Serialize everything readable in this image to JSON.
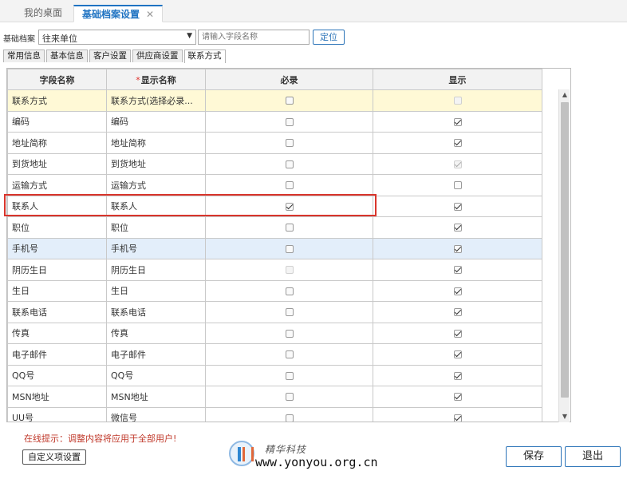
{
  "top_tabs": [
    {
      "label": "我的桌面"
    },
    {
      "label": "基础档案设置",
      "close": "✕"
    }
  ],
  "filter": {
    "label": "基础档案",
    "archive_value": "往来单位",
    "field_placeholder": "请输入字段名称",
    "locate_label": "定位"
  },
  "sub_tabs": [
    {
      "label": "常用信息"
    },
    {
      "label": "基本信息"
    },
    {
      "label": "客户设置"
    },
    {
      "label": "供应商设置"
    },
    {
      "label": "联系方式"
    }
  ],
  "grid": {
    "headers": {
      "field": "字段名称",
      "display_star": "*",
      "display": "显示名称",
      "required": "必录",
      "show": "显示"
    },
    "rows": [
      {
        "field": "联系方式",
        "display": "联系方式(选择必录...",
        "required": false,
        "required_disabled": false,
        "show": false,
        "show_disabled": true,
        "bg": "yellow"
      },
      {
        "field": "编码",
        "display": "编码",
        "required": false,
        "required_disabled": false,
        "show": true,
        "show_disabled": false,
        "bg": ""
      },
      {
        "field": "地址简称",
        "display": "地址简称",
        "required": false,
        "required_disabled": false,
        "show": true,
        "show_disabled": false,
        "bg": ""
      },
      {
        "field": "到货地址",
        "display": "到货地址",
        "required": false,
        "required_disabled": false,
        "show": true,
        "show_disabled": true,
        "bg": ""
      },
      {
        "field": "运输方式",
        "display": "运输方式",
        "required": false,
        "required_disabled": false,
        "show": false,
        "show_disabled": false,
        "bg": ""
      },
      {
        "field": "联系人",
        "display": "联系人",
        "required": true,
        "required_disabled": false,
        "show": true,
        "show_disabled": false,
        "bg": ""
      },
      {
        "field": "职位",
        "display": "职位",
        "required": false,
        "required_disabled": false,
        "show": true,
        "show_disabled": false,
        "bg": ""
      },
      {
        "field": "手机号",
        "display": "手机号",
        "required": false,
        "required_disabled": false,
        "show": true,
        "show_disabled": false,
        "bg": "blue"
      },
      {
        "field": "阴历生日",
        "display": "阴历生日",
        "required": false,
        "required_disabled": true,
        "show": true,
        "show_disabled": false,
        "bg": ""
      },
      {
        "field": "生日",
        "display": "生日",
        "required": false,
        "required_disabled": false,
        "show": true,
        "show_disabled": false,
        "bg": ""
      },
      {
        "field": "联系电话",
        "display": "联系电话",
        "required": false,
        "required_disabled": false,
        "show": true,
        "show_disabled": false,
        "bg": ""
      },
      {
        "field": "传真",
        "display": "传真",
        "required": false,
        "required_disabled": false,
        "show": true,
        "show_disabled": false,
        "bg": ""
      },
      {
        "field": "电子邮件",
        "display": "电子邮件",
        "required": false,
        "required_disabled": false,
        "show": true,
        "show_disabled": false,
        "bg": ""
      },
      {
        "field": "QQ号",
        "display": "QQ号",
        "required": false,
        "required_disabled": false,
        "show": true,
        "show_disabled": false,
        "bg": ""
      },
      {
        "field": "MSN地址",
        "display": "MSN地址",
        "required": false,
        "required_disabled": false,
        "show": true,
        "show_disabled": false,
        "bg": ""
      },
      {
        "field": "UU号",
        "display": "微信号",
        "required": false,
        "required_disabled": false,
        "show": true,
        "show_disabled": false,
        "bg": ""
      }
    ]
  },
  "footer": {
    "tip": "在线提示：调整内容将应用于全部用户!",
    "custom_label": "自定义项设置",
    "save_label": "保存",
    "exit_label": "退出"
  },
  "logo": {
    "company": "精华科技",
    "url": "www.yonyou.org.cn"
  },
  "colors": {
    "accent": "#1f73c2",
    "highlight_border": "#d9352c",
    "tip_text": "#c0392b",
    "row_yellow": "#fff9d6",
    "row_blue": "#e3eefa"
  }
}
